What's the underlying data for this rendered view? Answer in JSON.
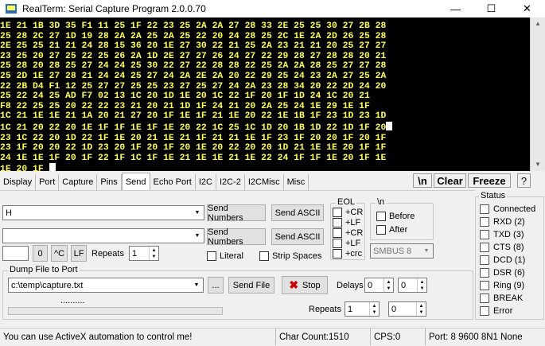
{
  "window": {
    "title": "RealTerm: Serial Capture Program 2.0.0.70"
  },
  "terminal": {
    "lines": [
      "1E 21 1B 3D 35 F1 11 25 1F 22 23 25 2A 2A 27 28 33 2E 25 25 30 27 2B 28",
      "25 28 2C 27 1D 19 28 2A 2A 25 2A 25 22 20 24 28 25 2C 1E 2A 2D 26 25 28",
      "2E 25 25 21 21 24 28 15 36 20 1E 27 30 22 21 25 2A 23 21 21 20 25 27 27",
      "23 25 20 27 25 22 25 26 2A 1D 2E 27 27 26 24 27 22 29 28 27 28 28 20 21",
      "25 28 20 28 25 27 24 24 25 30 22 27 22 28 28 22 25 2A 2A 28 25 27 27 28",
      "25 2D 1E 27 28 21 24 24 25 27 24 2A 2E 2A 20 22 29 25 24 23 2A 27 25 2A",
      "22 2B D4 F1 12 25 27 27 25 25 23 27 25 27 24 2A 23 28 34 20 22 2D 24 20",
      "25 22 24 25 AD F7 02 13 1C 20 1D 1E 20 1C 22 1F 20 1F 1D 24 1C 20 21",
      "F8 22 25 25 20 22 22 23 21 20 21 1D 1F 24 21 20 2A 25 24 1E 29 1E 1F",
      "1C 21 1E 1E 21 1A 20 21 27 20 1F 1E 1F 21 1E 20 22 1E 1B 1F 23 1D 23 1D",
      "1C 21 20 22 20 1E 1F 1F 1E 1F 1E 20 22 1C 25 1C 1D 20 1B 1D 22 1D 1F 20",
      "23 1C 22 20 1D 22 1F 1E 20 21 1E 21 1F 21 21 1E 1F 23 1F 20 20 1F 20 1F",
      "23 1F 20 20 22 1D 23 20 1F 20 1F 20 1E 20 22 20 20 1D 21 1E 1E 20 1F 1F",
      "24 1E 1E 1F 20 1F 22 1F 1C 1F 1E 21 1E 1E 21 1E 22 24 1F 1F 1E 20 1F 1E",
      "1E 20 1F "
    ]
  },
  "tabs": [
    "Display",
    "Port",
    "Capture",
    "Pins",
    "Send",
    "Echo Port",
    "I2C",
    "I2C-2",
    "I2CMisc",
    "Misc"
  ],
  "active_tab": "Send",
  "top_buttons": {
    "newline": "\\n",
    "clear": "Clear",
    "freeze": "Freeze",
    "help": "?"
  },
  "send": {
    "line1_value": "H",
    "line2_value": "",
    "send_numbers": "Send Numbers",
    "send_ascii": "Send ASCII",
    "zero_label": "0",
    "ctrl_c": "^C",
    "lf": "LF",
    "repeats_label": "Repeats",
    "repeats_value": "1",
    "literal": "Literal",
    "strip_spaces": "Strip Spaces",
    "smbus": "SMBUS 8"
  },
  "eol": {
    "legend": "EOL",
    "items": [
      "+CR",
      "+LF",
      "+CR",
      "+LF",
      "+crc"
    ]
  },
  "backslash_n": {
    "legend": "\\n",
    "before": "Before",
    "after": "After"
  },
  "dump": {
    "legend": "Dump File to Port",
    "file": "c:\\temp\\capture.txt",
    "browse": "...",
    "send_file": "Send File",
    "stop": "Stop",
    "delays_label": "Delays",
    "delay1": "0",
    "delay2": "0",
    "repeats_label": "Repeats",
    "repeats1": "1",
    "repeats2": "0",
    "dots": ".........."
  },
  "status": {
    "legend": "Status",
    "items": [
      "Connected",
      "RXD (2)",
      "TXD (3)",
      "CTS (8)",
      "DCD (1)",
      "DSR (6)",
      "Ring (9)",
      "BREAK",
      "Error"
    ]
  },
  "statusbar": {
    "message": "You can use ActiveX automation to control me!",
    "char_count": "Char Count:1510",
    "cps": "CPS:0",
    "port": "Port: 8 9600 8N1 None"
  },
  "colors": {
    "terminal_bg": "#000000",
    "terminal_fg": "#ffff55",
    "stop_icon": "#cc0000"
  }
}
